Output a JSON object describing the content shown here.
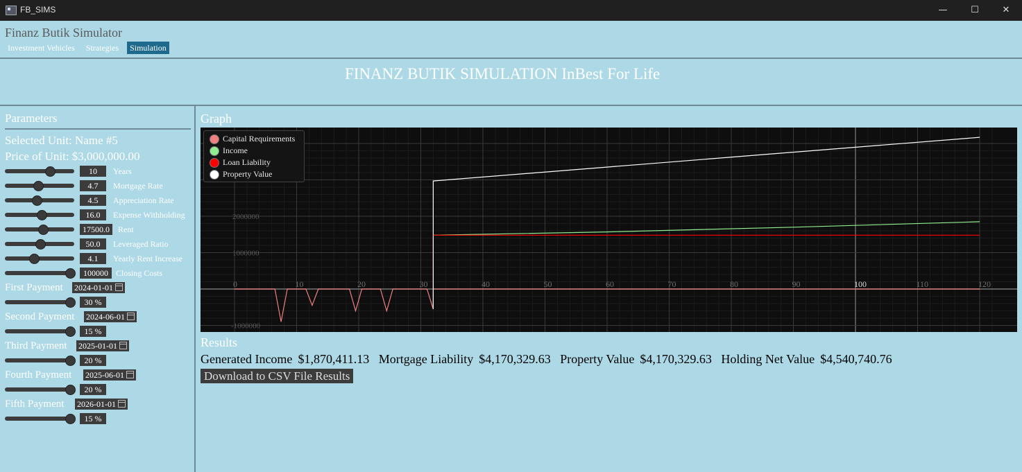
{
  "window": {
    "title": "FB_SIMS",
    "min": "—",
    "max": "☐",
    "close": "✕"
  },
  "header": {
    "app_name": "Finanz Butik Simulator",
    "tabs": [
      {
        "label": "Investment Vehicles",
        "active": false
      },
      {
        "label": "Strategies",
        "active": false
      },
      {
        "label": "Simulation",
        "active": true
      }
    ],
    "sim_title": "FINANZ BUTIK SIMULATION InBest For Life"
  },
  "params": {
    "title": "Parameters",
    "selected_unit": "Selected Unit: Name #5",
    "price": "Price of Unit: $3,000,000.00",
    "sliders": [
      {
        "value": "10",
        "label": "Years",
        "pos": 0.64
      },
      {
        "value": "4.7",
        "label": "Mortgage Rate",
        "pos": 0.47
      },
      {
        "value": "4.5",
        "label": "Appreciation Rate",
        "pos": 0.45
      },
      {
        "value": "16.0",
        "label": "Expense Withholding",
        "pos": 0.52
      },
      {
        "value": "17500.0",
        "label": "Rent",
        "pos": 0.54
      },
      {
        "value": "50.0",
        "label": "Leveraged Ratio",
        "pos": 0.5
      },
      {
        "value": "4.1",
        "label": "Yearly Rent Increase",
        "pos": 0.41
      },
      {
        "value": "100000",
        "label": "Closing Costs",
        "pos": 0.93
      }
    ],
    "payments": [
      {
        "label": "First Payment",
        "date": "2024-01-01",
        "percent": "30 %",
        "pos": 0.93
      },
      {
        "label": "Second Payment",
        "date": "2024-06-01",
        "percent": "15 %",
        "pos": 0.93
      },
      {
        "label": "Third Payment",
        "date": "2025-01-01",
        "percent": "20 %",
        "pos": 0.93
      },
      {
        "label": "Fourth Payment",
        "date": "2025-06-01",
        "percent": "20 %",
        "pos": 0.93
      },
      {
        "label": "Fifth Payment",
        "date": "2026-01-01",
        "percent": "15 %",
        "pos": 0.93
      }
    ]
  },
  "graph": {
    "title": "Graph"
  },
  "chart_data": {
    "type": "line",
    "x_ticks": [
      "0",
      "10",
      "20",
      "30",
      "40",
      "50",
      "60",
      "70",
      "80",
      "90",
      "100",
      "110",
      "120"
    ],
    "y_ticks": [
      "-1000000",
      "1000000",
      "2000000"
    ],
    "xlim": [
      0,
      122
    ],
    "ylim": [
      -1150000,
      4400000
    ],
    "grid": true,
    "legend_placement": "top-left",
    "series": [
      {
        "name": "Capital Requirements",
        "color": "#f08080",
        "points": [
          [
            0,
            0
          ],
          [
            6.5,
            0
          ],
          [
            7.5,
            -900000
          ],
          [
            8.5,
            0
          ],
          [
            11.5,
            0
          ],
          [
            12.5,
            -450000
          ],
          [
            13.5,
            0
          ],
          [
            18.5,
            0
          ],
          [
            19.5,
            -600000
          ],
          [
            20.5,
            0
          ],
          [
            23.5,
            0
          ],
          [
            24.5,
            -600000
          ],
          [
            25.5,
            0
          ],
          [
            31,
            0
          ],
          [
            32,
            -550000
          ],
          [
            32,
            0
          ],
          [
            120,
            0
          ]
        ]
      },
      {
        "name": "Income",
        "color": "#90ee90",
        "points": [
          [
            32,
            1480000
          ],
          [
            60,
            1570000
          ],
          [
            90,
            1700000
          ],
          [
            120,
            1850000
          ]
        ]
      },
      {
        "name": "Loan Liability",
        "color": "#ff0000",
        "points": [
          [
            32,
            0
          ],
          [
            32,
            1480000
          ],
          [
            120,
            1480000
          ]
        ]
      },
      {
        "name": "Property Value",
        "color": "#ffffff",
        "points": [
          [
            32,
            -550000
          ],
          [
            32,
            2970000
          ],
          [
            120,
            4170000
          ]
        ]
      }
    ]
  },
  "results": {
    "title": "Results",
    "items": [
      {
        "key": "Generated Income",
        "value": "$1,870,411.13"
      },
      {
        "key": "Mortgage Liability",
        "value": "$4,170,329.63"
      },
      {
        "key": "Property Value",
        "value": "$4,170,329.63"
      },
      {
        "key": "Holding Net Value",
        "value": "$4,540,740.76"
      }
    ],
    "download_label": "Download to CSV File Results"
  }
}
